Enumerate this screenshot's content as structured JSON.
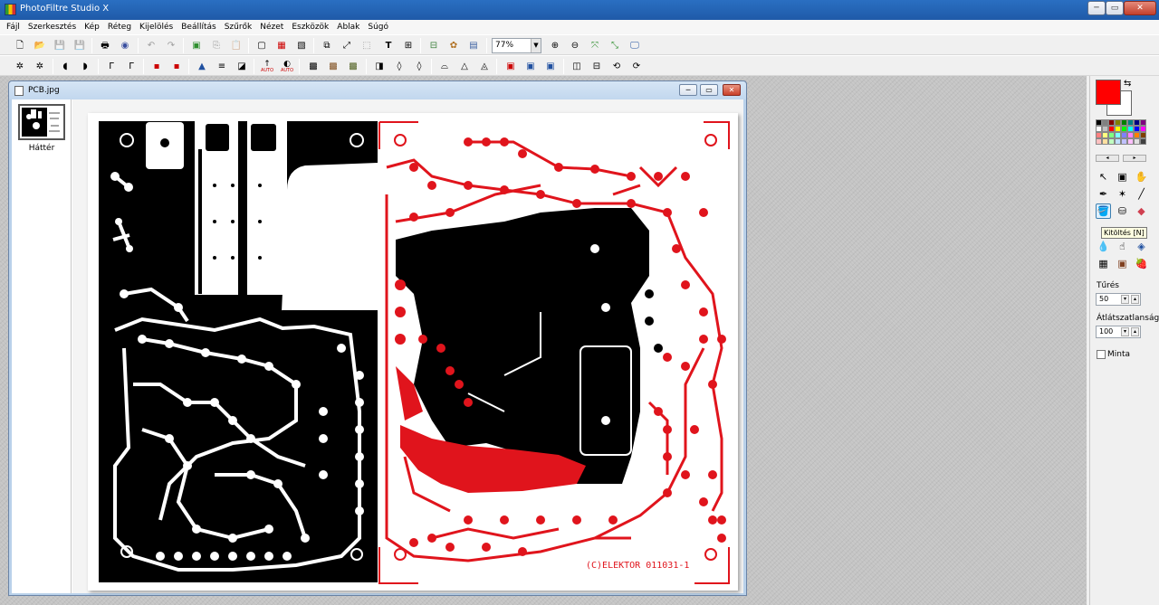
{
  "app": {
    "title": "PhotoFiltre Studio X"
  },
  "menu": [
    "Fájl",
    "Szerkesztés",
    "Kép",
    "Réteg",
    "Kijelölés",
    "Beállítás",
    "Szűrők",
    "Nézet",
    "Eszközök",
    "Ablak",
    "Súgó"
  ],
  "toolbar1": {
    "zoom": "77%",
    "icons": [
      "new-icon",
      "open-icon",
      "save-icon",
      "save-as-icon",
      "print-icon",
      "scan-icon",
      "undo-icon",
      "redo-icon",
      "paste-as-image-icon",
      "copy-icon",
      "paste-icon",
      "new-layer-icon",
      "layer-icon",
      "layer-color-icon",
      "crop-icon",
      "resize-icon",
      "selection-icon",
      "text-icon",
      "canvas-size-icon",
      "layers-manager-icon",
      "plugins-icon",
      "zoom-in-icon",
      "zoom-out-icon",
      "fit-icon",
      "actual-size-icon",
      "fullscreen-icon"
    ]
  },
  "toolbar2": {
    "auto_label_1": "AUTO",
    "auto_label_2": "AUTO"
  },
  "document": {
    "title": "PCB.jpg",
    "layer_label": "Háttér",
    "silkscreen_text": "(C)ELEKTOR  011031-1"
  },
  "palette_colors": [
    "#000000",
    "#808080",
    "#800000",
    "#808000",
    "#008000",
    "#008080",
    "#000080",
    "#800080",
    "#ffffff",
    "#c0c0c0",
    "#ff0000",
    "#ffff00",
    "#00ff00",
    "#00ffff",
    "#0000ff",
    "#ff00ff",
    "#ff8080",
    "#ffff80",
    "#80ff80",
    "#80ffff",
    "#8080ff",
    "#ff80ff",
    "#ff8000",
    "#804000",
    "#ffc0c0",
    "#ffe0a0",
    "#c0ffc0",
    "#c0e0ff",
    "#c0c0ff",
    "#ffc0ff",
    "#e0e0e0",
    "#404040"
  ],
  "colors": {
    "foreground": "#ff0000",
    "background": "#ffffff",
    "pcb_red": "#e0141c"
  },
  "tools": {
    "tooltip": "Kitöltés [N]",
    "tolerance_label": "Tűrés",
    "tolerance_value": "50",
    "opacity_label": "Átlátszatlanság",
    "opacity_value": "100",
    "pattern_label": "Minta"
  }
}
